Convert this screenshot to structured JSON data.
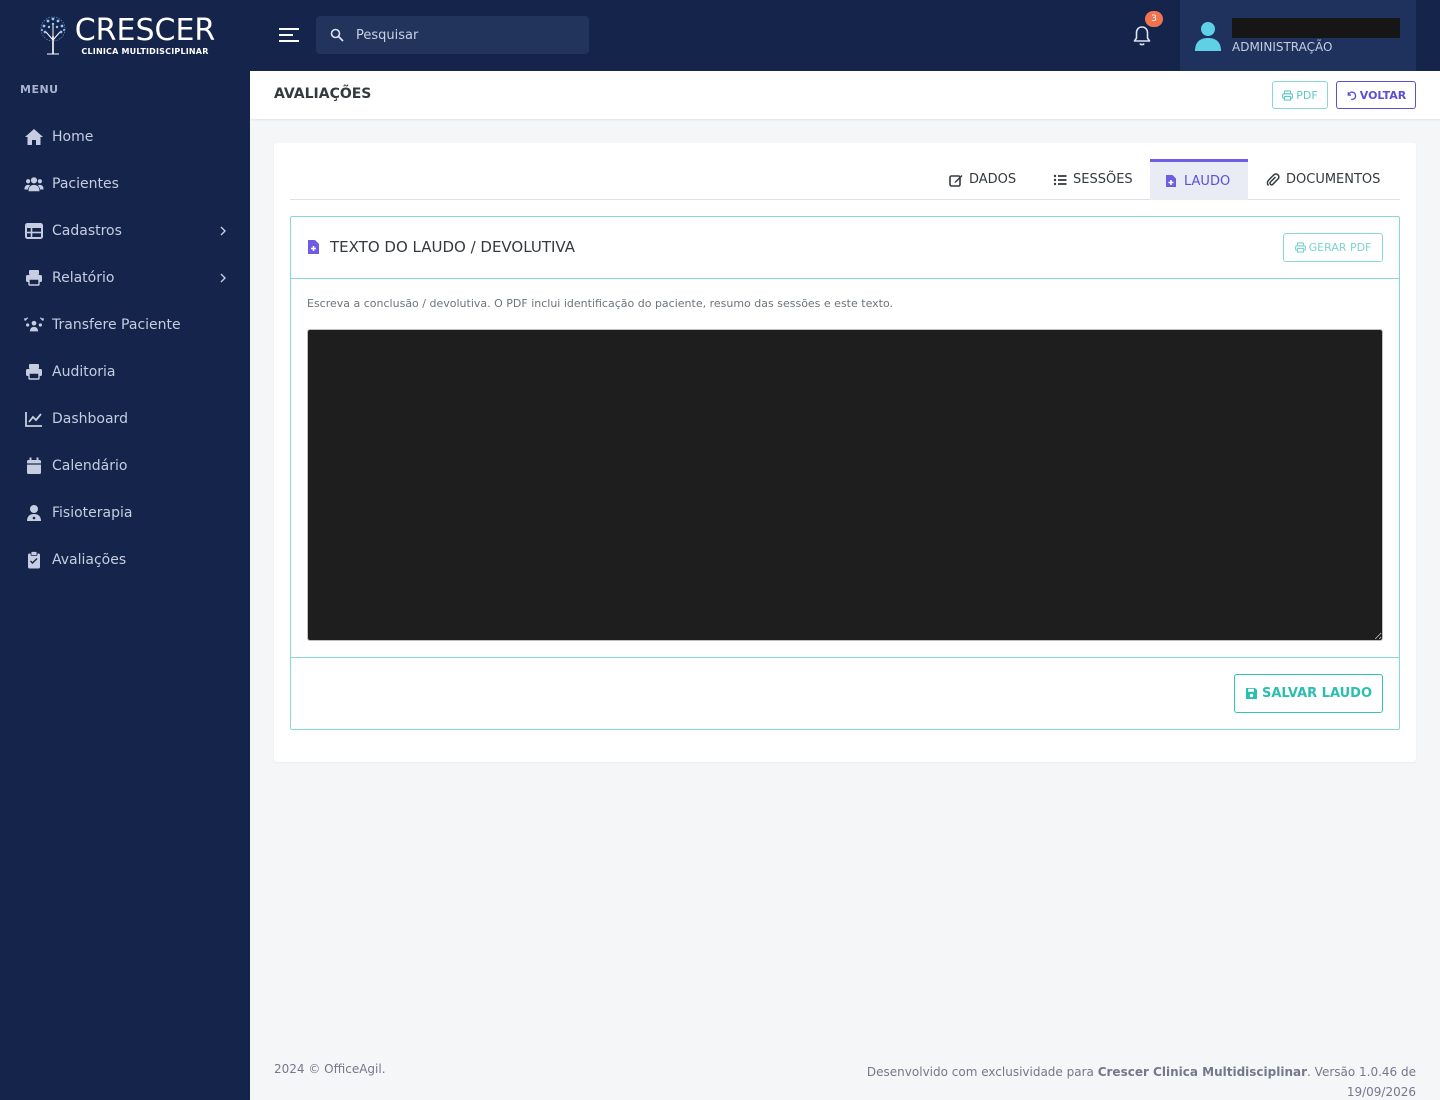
{
  "brand": {
    "name": "CRESCER",
    "subtitle": "CLINICA MULTIDISCIPLINAR"
  },
  "sidebar": {
    "menu_title": "MENU",
    "items": [
      {
        "label": "Home",
        "icon": "home-icon",
        "has_submenu": false
      },
      {
        "label": "Pacientes",
        "icon": "users-icon",
        "has_submenu": false
      },
      {
        "label": "Cadastros",
        "icon": "table-icon",
        "has_submenu": true
      },
      {
        "label": "Relatório",
        "icon": "printer-icon",
        "has_submenu": true
      },
      {
        "label": "Transfere Paciente",
        "icon": "people-transfer-icon",
        "has_submenu": false
      },
      {
        "label": "Auditoria",
        "icon": "printer-icon",
        "has_submenu": false
      },
      {
        "label": "Dashboard",
        "icon": "chart-line-icon",
        "has_submenu": false
      },
      {
        "label": "Calendário",
        "icon": "calendar-icon",
        "has_submenu": false
      },
      {
        "label": "Fisioterapia",
        "icon": "user-doctor-icon",
        "has_submenu": false
      },
      {
        "label": "Avaliações",
        "icon": "clipboard-icon",
        "has_submenu": false
      }
    ]
  },
  "topbar": {
    "search_placeholder": "Pesquisar",
    "notification_count": "3",
    "user": {
      "name": "",
      "role": "ADMINISTRAÇÃO"
    }
  },
  "page": {
    "title": "AVALIAÇÕES",
    "pdf_label": "PDF",
    "back_label": "VOLTAR"
  },
  "tabs": [
    {
      "label": "DADOS",
      "icon": "edit-icon",
      "active": false
    },
    {
      "label": "SESSÕES",
      "icon": "list-icon",
      "active": false
    },
    {
      "label": "LAUDO",
      "icon": "file-medical-icon",
      "active": true
    },
    {
      "label": "DOCUMENTOS",
      "icon": "paperclip-icon",
      "active": false
    }
  ],
  "laudo": {
    "title": "TEXTO DO LAUDO / DEVOLUTIVA",
    "generate_pdf_label": "GERAR PDF",
    "hint": "Escreva a conclusão / devolutiva. O PDF inclui identificação do paciente, resumo das sessões e este texto.",
    "text_value": "",
    "save_label": "SALVAR LAUDO"
  },
  "footer": {
    "copyright": "2024 © OfficeAgil.",
    "developed_prefix": "Desenvolvido com exclusividade para ",
    "developed_for": "Crescer Clinica Multidisciplinar",
    "version_text": ". Versão 1.0.46 de 19/09/2026"
  },
  "colors": {
    "sidebar_bg": "#14244b",
    "accent_purple": "#5a4fd6",
    "accent_teal": "#2ec4b6",
    "badge_orange": "#f1734f",
    "avatar_cyan": "#5fd0e6"
  }
}
